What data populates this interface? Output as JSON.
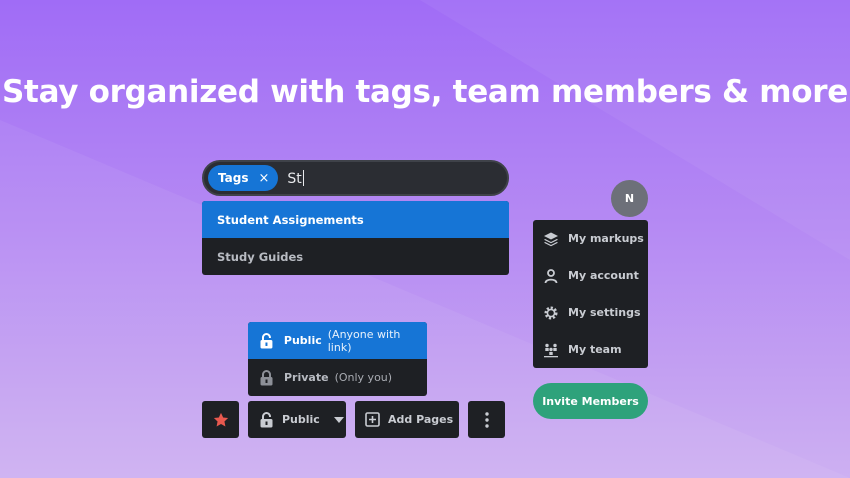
{
  "headline": "Stay organized with tags, team members & more",
  "search": {
    "tag_label": "Tags",
    "tag_remove_glyph": "×",
    "query": "St"
  },
  "suggestions": [
    {
      "label": "Student Assignements",
      "selected": true
    },
    {
      "label": "Study Guides",
      "selected": false
    }
  ],
  "avatar_initial": "N",
  "profile_menu": [
    {
      "label": "My markups",
      "icon": "layers-icon"
    },
    {
      "label": "My account",
      "icon": "user-icon"
    },
    {
      "label": "My settings",
      "icon": "gear-icon"
    },
    {
      "label": "My team",
      "icon": "team-icon"
    }
  ],
  "invite_label": "Invite Members",
  "visibility_options": [
    {
      "title": "Public",
      "subtitle": "(Anyone with link)",
      "selected": true,
      "icon": "unlock-icon"
    },
    {
      "title": "Private",
      "subtitle": "(Only you)",
      "selected": false,
      "icon": "lock-icon"
    }
  ],
  "toolbar": {
    "public_label": "Public",
    "add_pages_label": "Add Pages"
  },
  "colors": {
    "accent_blue": "#1675d6",
    "invite_green": "#2ea27b",
    "star_red": "#e8594f",
    "panel_dark": "#1e2024"
  }
}
